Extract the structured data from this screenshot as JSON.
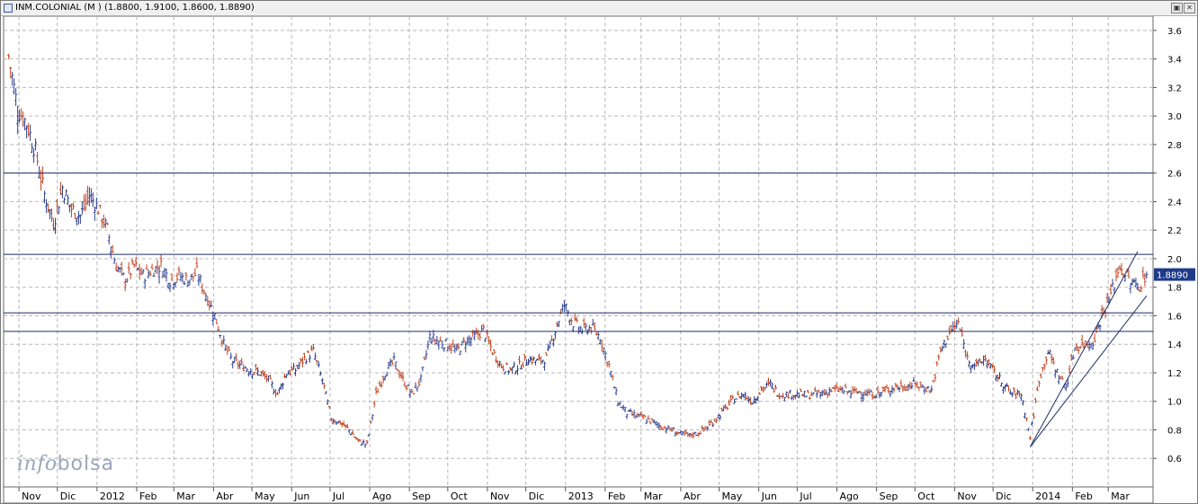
{
  "window": {
    "title": "INM.COLONIAL (M ) (1.8800, 1.9100, 1.8600, 1.8890)",
    "restore_icon": "restore-icon",
    "close_icon": "close-icon"
  },
  "logo": {
    "part1": "info",
    "part2": "bolsa"
  },
  "colors": {
    "up": "#2b3f8f",
    "down": "#c0431f",
    "line": "#1f2d66",
    "grid": "#b8b8b8",
    "badge": "#1f3a8a"
  },
  "chart_data": {
    "type": "ohlc",
    "ylim": [
      0.4,
      3.7
    ],
    "yticks": [
      0.6,
      0.8,
      1.0,
      1.2,
      1.4,
      1.6,
      1.8,
      2.0,
      2.2,
      2.4,
      2.6,
      2.8,
      3.0,
      3.2,
      3.4,
      3.6
    ],
    "ytick_labels": [
      "0.6",
      "0.8",
      "1.0",
      "1.2",
      "1.4",
      "1.6",
      "1.8",
      "2.0",
      "2.2",
      "2.4",
      "2.6",
      "2.8",
      "3.0",
      "3.2",
      "3.4",
      "3.6"
    ],
    "months": [
      "Nov",
      "Dic",
      "2012",
      "Feb",
      "Mar",
      "Abr",
      "May",
      "Jun",
      "Jul",
      "Ago",
      "Sep",
      "Oct",
      "Nov",
      "Dic",
      "2013",
      "Feb",
      "Mar",
      "Abr",
      "May",
      "Jun",
      "Jul",
      "Ago",
      "Sep",
      "Oct",
      "Nov",
      "Dic",
      "2014",
      "Feb",
      "Mar"
    ],
    "last_price": "1.8890",
    "horizontal_lines": [
      2.6,
      2.03,
      1.62,
      1.49
    ],
    "channel": [
      {
        "from": [
          "2013-12-30",
          0.68
        ],
        "to": [
          "2014-03-24",
          2.05
        ]
      },
      {
        "from": [
          "2013-12-30",
          0.68
        ],
        "to": [
          "2014-03-31",
          1.74
        ]
      }
    ],
    "series_weekly_close": [
      [
        "2011-10-24",
        3.42
      ],
      [
        "2011-10-31",
        3.05
      ],
      [
        "2011-11-07",
        2.95
      ],
      [
        "2011-11-14",
        2.75
      ],
      [
        "2011-11-21",
        2.45
      ],
      [
        "2011-11-28",
        2.25
      ],
      [
        "2011-12-05",
        2.5
      ],
      [
        "2011-12-12",
        2.35
      ],
      [
        "2011-12-19",
        2.3
      ],
      [
        "2011-12-26",
        2.45
      ],
      [
        "2012-01-02",
        2.35
      ],
      [
        "2012-01-09",
        2.2
      ],
      [
        "2012-01-16",
        1.95
      ],
      [
        "2012-01-23",
        1.85
      ],
      [
        "2012-01-30",
        1.95
      ],
      [
        "2012-02-06",
        1.88
      ],
      [
        "2012-02-13",
        1.92
      ],
      [
        "2012-02-20",
        1.95
      ],
      [
        "2012-02-27",
        1.85
      ],
      [
        "2012-03-05",
        1.88
      ],
      [
        "2012-03-12",
        1.85
      ],
      [
        "2012-03-19",
        1.9
      ],
      [
        "2012-03-26",
        1.75
      ],
      [
        "2012-04-02",
        1.6
      ],
      [
        "2012-04-09",
        1.4
      ],
      [
        "2012-04-16",
        1.28
      ],
      [
        "2012-04-23",
        1.25
      ],
      [
        "2012-04-30",
        1.22
      ],
      [
        "2012-05-07",
        1.2
      ],
      [
        "2012-05-14",
        1.15
      ],
      [
        "2012-05-21",
        1.05
      ],
      [
        "2012-05-28",
        1.2
      ],
      [
        "2012-06-04",
        1.22
      ],
      [
        "2012-06-11",
        1.3
      ],
      [
        "2012-06-18",
        1.35
      ],
      [
        "2012-06-25",
        1.15
      ],
      [
        "2012-07-02",
        0.88
      ],
      [
        "2012-07-09",
        0.85
      ],
      [
        "2012-07-16",
        0.8
      ],
      [
        "2012-07-23",
        0.72
      ],
      [
        "2012-07-30",
        0.7
      ],
      [
        "2012-08-06",
        1.05
      ],
      [
        "2012-08-13",
        1.2
      ],
      [
        "2012-08-20",
        1.28
      ],
      [
        "2012-08-27",
        1.15
      ],
      [
        "2012-09-03",
        1.05
      ],
      [
        "2012-09-10",
        1.15
      ],
      [
        "2012-09-17",
        1.45
      ],
      [
        "2012-09-24",
        1.42
      ],
      [
        "2012-10-01",
        1.4
      ],
      [
        "2012-10-08",
        1.35
      ],
      [
        "2012-10-15",
        1.42
      ],
      [
        "2012-10-22",
        1.45
      ],
      [
        "2012-10-29",
        1.5
      ],
      [
        "2012-11-05",
        1.35
      ],
      [
        "2012-11-12",
        1.25
      ],
      [
        "2012-11-19",
        1.22
      ],
      [
        "2012-11-26",
        1.25
      ],
      [
        "2012-12-03",
        1.3
      ],
      [
        "2012-12-10",
        1.28
      ],
      [
        "2012-12-17",
        1.3
      ],
      [
        "2012-12-24",
        1.5
      ],
      [
        "2012-12-31",
        1.68
      ],
      [
        "2013-01-07",
        1.55
      ],
      [
        "2013-01-14",
        1.5
      ],
      [
        "2013-01-21",
        1.52
      ],
      [
        "2013-01-28",
        1.45
      ],
      [
        "2013-02-04",
        1.25
      ],
      [
        "2013-02-11",
        1.0
      ],
      [
        "2013-02-18",
        0.92
      ],
      [
        "2013-02-25",
        0.9
      ],
      [
        "2013-03-04",
        0.88
      ],
      [
        "2013-03-11",
        0.85
      ],
      [
        "2013-03-18",
        0.82
      ],
      [
        "2013-03-25",
        0.8
      ],
      [
        "2013-04-01",
        0.77
      ],
      [
        "2013-04-08",
        0.76
      ],
      [
        "2013-04-15",
        0.78
      ],
      [
        "2013-04-22",
        0.82
      ],
      [
        "2013-04-29",
        0.88
      ],
      [
        "2013-05-06",
        0.95
      ],
      [
        "2013-05-13",
        1.02
      ],
      [
        "2013-05-20",
        1.05
      ],
      [
        "2013-05-27",
        1.0
      ],
      [
        "2013-06-03",
        1.08
      ],
      [
        "2013-06-10",
        1.12
      ],
      [
        "2013-06-17",
        1.05
      ],
      [
        "2013-06-24",
        1.05
      ],
      [
        "2013-07-01",
        1.05
      ],
      [
        "2013-07-08",
        1.04
      ],
      [
        "2013-07-15",
        1.05
      ],
      [
        "2013-07-22",
        1.06
      ],
      [
        "2013-07-29",
        1.08
      ],
      [
        "2013-08-05",
        1.08
      ],
      [
        "2013-08-12",
        1.06
      ],
      [
        "2013-08-19",
        1.07
      ],
      [
        "2013-08-26",
        1.05
      ],
      [
        "2013-09-02",
        1.05
      ],
      [
        "2013-09-09",
        1.08
      ],
      [
        "2013-09-16",
        1.1
      ],
      [
        "2013-09-23",
        1.1
      ],
      [
        "2013-09-30",
        1.12
      ],
      [
        "2013-10-07",
        1.1
      ],
      [
        "2013-10-14",
        1.08
      ],
      [
        "2013-10-21",
        1.35
      ],
      [
        "2013-10-28",
        1.48
      ],
      [
        "2013-11-04",
        1.55
      ],
      [
        "2013-11-11",
        1.3
      ],
      [
        "2013-11-18",
        1.25
      ],
      [
        "2013-11-25",
        1.3
      ],
      [
        "2013-12-02",
        1.2
      ],
      [
        "2013-12-09",
        1.12
      ],
      [
        "2013-12-16",
        1.05
      ],
      [
        "2013-12-23",
        1.05
      ],
      [
        "2013-12-30",
        0.75
      ],
      [
        "2014-01-06",
        1.15
      ],
      [
        "2014-01-13",
        1.35
      ],
      [
        "2014-01-20",
        1.2
      ],
      [
        "2014-01-27",
        1.1
      ],
      [
        "2014-02-03",
        1.38
      ],
      [
        "2014-02-10",
        1.4
      ],
      [
        "2014-02-17",
        1.42
      ],
      [
        "2014-02-24",
        1.6
      ],
      [
        "2014-03-03",
        1.75
      ],
      [
        "2014-03-10",
        1.95
      ],
      [
        "2014-03-17",
        1.85
      ],
      [
        "2014-03-24",
        1.8
      ],
      [
        "2014-03-31",
        1.889
      ]
    ]
  }
}
